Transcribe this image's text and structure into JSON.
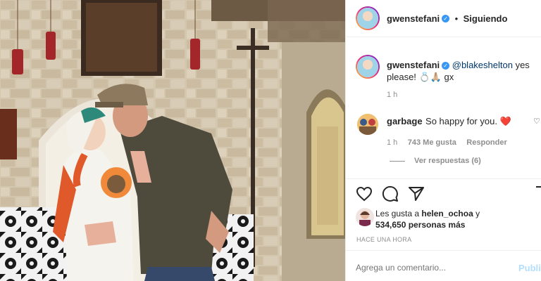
{
  "post": {
    "author": "gwenstefani",
    "follow_status": "Siguiendo",
    "dot": "•",
    "caption_mention": "@blakeshelton",
    "caption_text": " yes please! 💍🙏🏼 gx",
    "caption_time": "1 h"
  },
  "comments": [
    {
      "user": "garbage",
      "text": "So happy for you. ❤️",
      "time": "1 h",
      "likes": "743 Me gusta",
      "reply_label": "Responder",
      "view_replies": "Ver respuestas (6)"
    }
  ],
  "likes": {
    "prefix": "Les gusta a ",
    "user": "helen_ochoa",
    "suffix": " y",
    "count_line": "534,650 personas más"
  },
  "timestamp": "HACE UNA HORA",
  "comment_box": {
    "placeholder": "Agrega un comentario...",
    "publish_label": "Publicar"
  },
  "icons": {
    "like": "heart-icon",
    "comment": "comment-icon",
    "share": "share-icon",
    "save": "bookmark-icon",
    "verified": "verified-badge-icon",
    "comment_like": "small-heart-icon"
  },
  "colors": {
    "verified_blue": "#3897f0",
    "link_blue": "#00376b",
    "muted_gray": "#8e8e8e",
    "publish_blue": "#b2dffc"
  }
}
